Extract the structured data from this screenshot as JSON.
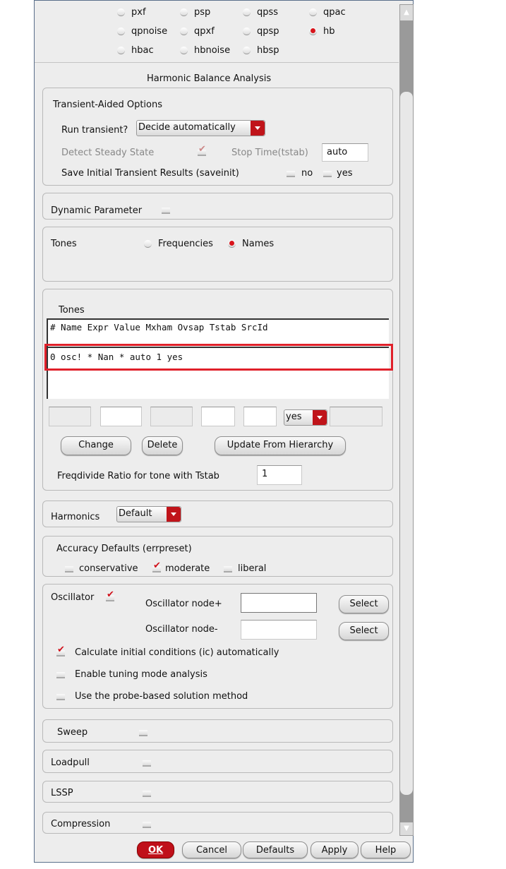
{
  "analysis_types": [
    {
      "label": "pxf",
      "selected": false
    },
    {
      "label": "psp",
      "selected": false
    },
    {
      "label": "qpss",
      "selected": false
    },
    {
      "label": "qpac",
      "selected": false
    },
    {
      "label": "qpnoise",
      "selected": false
    },
    {
      "label": "qpxf",
      "selected": false
    },
    {
      "label": "qpsp",
      "selected": false
    },
    {
      "label": "hb",
      "selected": true
    },
    {
      "label": "hbac",
      "selected": false
    },
    {
      "label": "hbnoise",
      "selected": false
    },
    {
      "label": "hbsp",
      "selected": false
    }
  ],
  "section_title": "Harmonic Balance Analysis",
  "transient": {
    "title": "Transient-Aided Options",
    "run_label": "Run transient?",
    "run_value": "Decide automatically",
    "detect_label": "Detect Steady State",
    "stop_label": "Stop Time(tstab)",
    "stop_value": "auto",
    "saveinit_label": "Save Initial Transient Results (saveinit)",
    "no": "no",
    "yes": "yes"
  },
  "dynamic": {
    "label": "Dynamic Parameter"
  },
  "tones_mode": {
    "label": "Tones",
    "frequencies": "Frequencies",
    "names": "Names"
  },
  "tones_table": {
    "title": "Tones",
    "header": "# Name   Expr       Value    Mxham Ovsap Tstab    SrcId",
    "rows": [
      "0 osc!             * Nan *   auto  1     yes"
    ],
    "tstab_select": "yes",
    "change": "Change",
    "delete": "Delete",
    "update": "Update From Hierarchy",
    "freqdivide_label": "Freqdivide Ratio for tone with Tstab",
    "freqdivide_value": "1"
  },
  "harmonics": {
    "label": "Harmonics",
    "value": "Default"
  },
  "accuracy": {
    "title": "Accuracy Defaults (errpreset)",
    "conservative": "conservative",
    "moderate": "moderate",
    "liberal": "liberal"
  },
  "oscillator": {
    "label": "Oscillator",
    "node_plus": "Oscillator node+",
    "node_minus": "Oscillator node-",
    "select": "Select",
    "calc_ic": "Calculate initial conditions (ic) automatically",
    "tuning": "Enable tuning mode analysis",
    "probe": "Use the probe-based solution method"
  },
  "sweep": "Sweep",
  "loadpull": "Loadpull",
  "lssp": "LSSP",
  "compression": "Compression",
  "buttons": {
    "ok": "OK",
    "cancel": "Cancel",
    "defaults": "Defaults",
    "apply": "Apply",
    "help": "Help"
  }
}
